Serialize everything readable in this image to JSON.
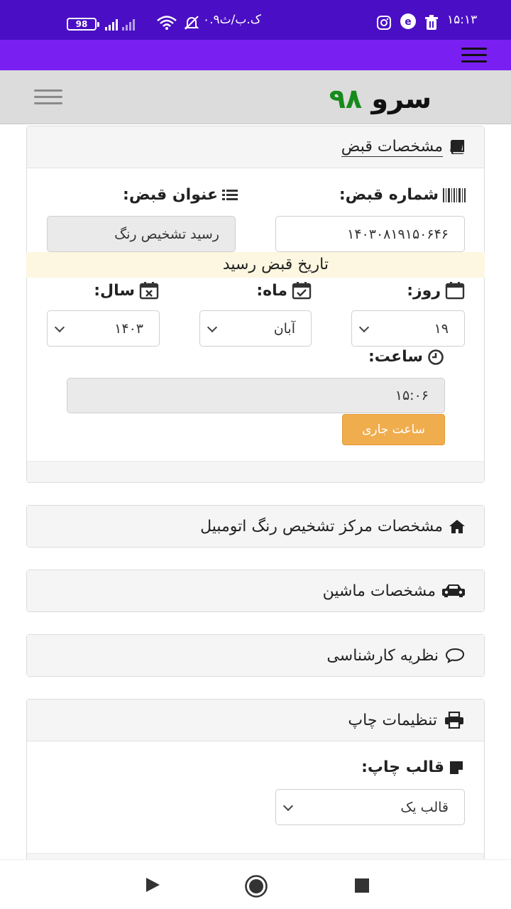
{
  "status_bar": {
    "time": "۱۵:۱۳",
    "carrier": "۰.۹ک.ب/ث",
    "battery": "98"
  },
  "app": {
    "brand_text": "سرو",
    "brand_number": "۹۸"
  },
  "receipt_section": {
    "title": "مشخصات قبض",
    "receipt_number_label": "شماره قبض:",
    "receipt_number_value": "۱۴۰۳۰۸۱۹۱۵۰۶۴۶",
    "receipt_title_label": "عنوان قبض:",
    "receipt_title_value": "رسید تشخیص رنگ",
    "date_banner": "تاریخ قبض رسید",
    "day_label": "روز:",
    "day_value": "۱۹",
    "month_label": "ماه:",
    "month_value": "آبان",
    "year_label": "سال:",
    "year_value": "۱۴۰۳",
    "time_label": "ساعت:",
    "time_value": "۱۵:۰۶",
    "current_time_button": "ساعت جاری"
  },
  "sections": {
    "center": "مشخصات مرکز تشخیص رنگ اتومبیل",
    "car": "مشخصات ماشین",
    "expert": "نظریه کارشناسی",
    "print": "تنظیمات چاپ"
  },
  "print_settings": {
    "template_label": "قالب چاپ:",
    "template_value": "قالب یک"
  }
}
